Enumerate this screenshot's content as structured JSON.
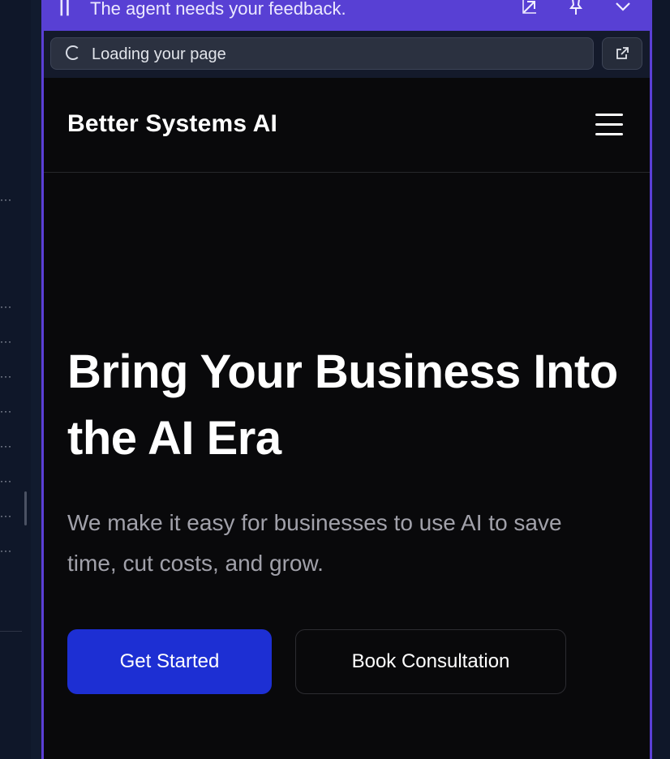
{
  "agent_panel": {
    "feedback_message": "The agent needs your feedback.",
    "pause_icon": "pause-icon",
    "actions": [
      "expand-arrow-icon",
      "pin-icon",
      "chevron-down-icon"
    ],
    "accent_color": "#5840d4"
  },
  "browser": {
    "loading_text": "Loading your page",
    "open_external_icon": "external-link-icon"
  },
  "site": {
    "brand": "Better Systems AI",
    "menu_icon": "hamburger-menu-icon",
    "hero": {
      "title": "Bring Your Business Into the AI Era",
      "subtitle": "We make it easy for businesses to use AI to save time, cut costs, and grow.",
      "primary_cta": "Get Started",
      "secondary_cta": "Book Consultation"
    },
    "colors": {
      "background": "#09090b",
      "primary_button": "#1d2fd3"
    }
  }
}
